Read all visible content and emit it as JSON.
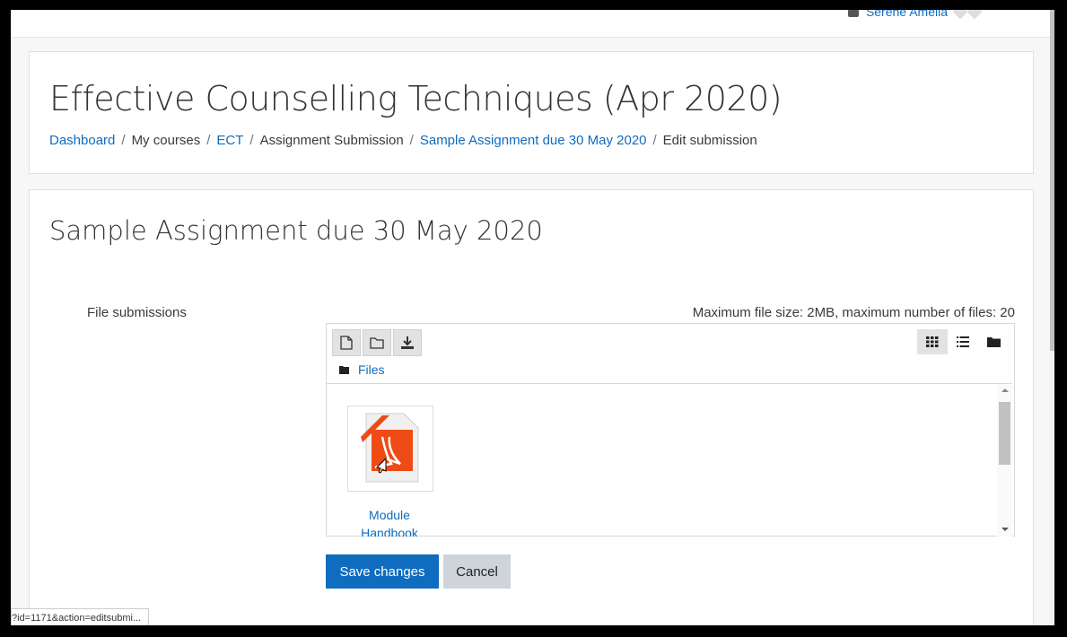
{
  "user": {
    "name": "Serene Amelia"
  },
  "course": {
    "title": "Effective Counselling Techniques (Apr 2020)"
  },
  "breadcrumb": {
    "items": [
      {
        "label": "Dashboard",
        "link": true
      },
      {
        "label": "My courses",
        "link": false
      },
      {
        "label": "ECT",
        "link": true
      },
      {
        "label": "Assignment Submission",
        "link": false
      },
      {
        "label": "Sample Assignment due 30 May 2020",
        "link": true
      },
      {
        "label": "Edit submission",
        "link": false
      }
    ],
    "separator": "/"
  },
  "assignment": {
    "title": "Sample Assignment due 30 May 2020",
    "field_label": "File submissions",
    "limits": "Maximum file size: 2MB, maximum number of files: 20"
  },
  "filemanager": {
    "toolbar": [
      "add-file-icon",
      "create-folder-icon",
      "download-icon"
    ],
    "views": [
      "grid-view-icon",
      "list-view-icon",
      "tree-view-icon"
    ],
    "active_view": "grid-view-icon",
    "path_label": "Files",
    "files": [
      {
        "name_line1": "Module",
        "name_line2": "Handbook",
        "type": "pdf"
      }
    ]
  },
  "buttons": {
    "save": "Save changes",
    "cancel": "Cancel"
  },
  "status_url": "?id=1171&action=editsubmi..."
}
